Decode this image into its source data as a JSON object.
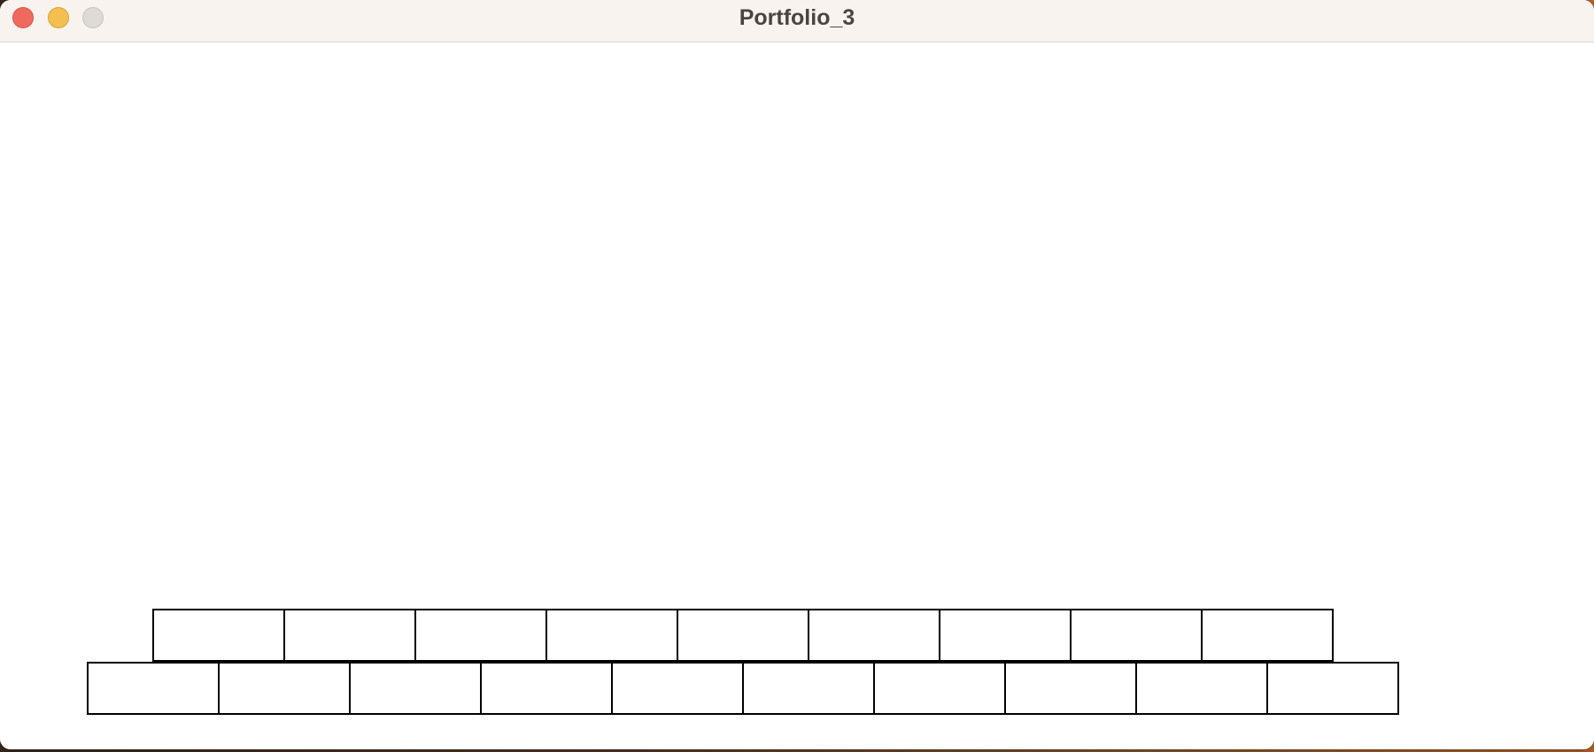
{
  "window": {
    "title": "Portfolio_3",
    "controls": {
      "close_color": "#ef6a5e",
      "minimize_color": "#f5bf4f",
      "zoom_color": "#dedad6"
    }
  },
  "canvas": {
    "background": "#ffffff",
    "brick_rows": [
      {
        "name": "top",
        "brick_count": 9
      },
      {
        "name": "bottom",
        "brick_count": 10
      }
    ],
    "brick_border_color": "#000000"
  }
}
